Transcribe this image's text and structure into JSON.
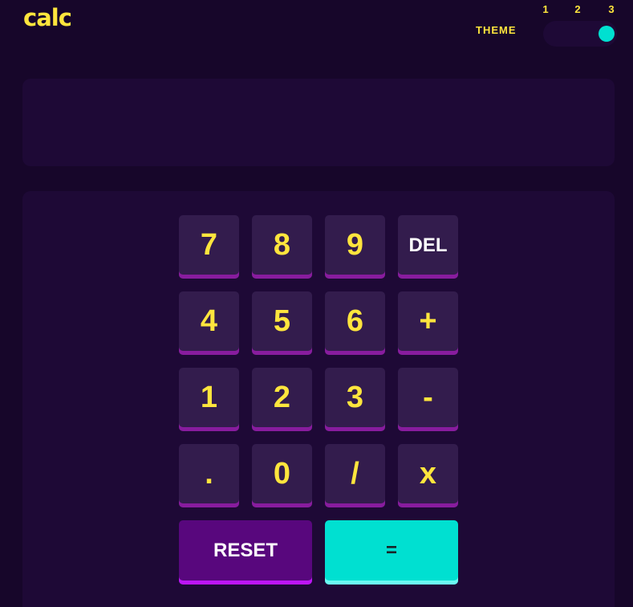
{
  "header": {
    "app_title": "calc",
    "theme_label": "THEME",
    "theme_options": [
      "1",
      "2",
      "3"
    ],
    "theme_selected": "3"
  },
  "display": {
    "value": ""
  },
  "keypad": {
    "rows": [
      [
        "7",
        "8",
        "9",
        "DEL"
      ],
      [
        "4",
        "5",
        "6",
        "+"
      ],
      [
        "1",
        "2",
        "3",
        "-"
      ],
      [
        ".",
        "0",
        "/",
        "x"
      ]
    ],
    "reset_label": "RESET",
    "equals_label": "="
  },
  "colors": {
    "background": "#17062a",
    "panel": "#1e0936",
    "key": "#331c4d",
    "key_shadow": "#881c9e",
    "key_text": "#ffe53d",
    "reset": "#58077d",
    "equals": "#00e0d1"
  }
}
